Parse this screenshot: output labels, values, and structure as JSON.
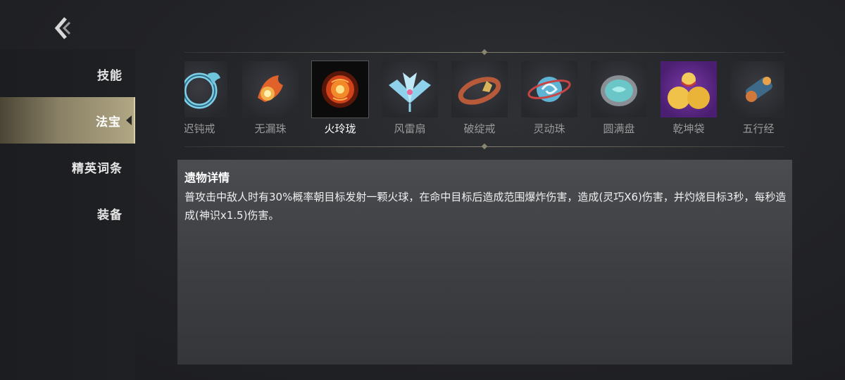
{
  "sidebar": {
    "items": [
      {
        "label": "技能"
      },
      {
        "label": "法宝"
      },
      {
        "label": "精英词条"
      },
      {
        "label": "装备"
      }
    ]
  },
  "treasures": [
    {
      "label": "迟钝戒",
      "icon": "blue-dragon-ring-icon"
    },
    {
      "label": "无漏珠",
      "icon": "flame-pearl-icon"
    },
    {
      "label": "火玲珑",
      "icon": "fire-orb-icon",
      "selected": true
    },
    {
      "label": "风雷扇",
      "icon": "ice-fan-icon"
    },
    {
      "label": "破绽戒",
      "icon": "golden-ring-icon"
    },
    {
      "label": "灵动珠",
      "icon": "swirl-pearl-icon"
    },
    {
      "label": "圆满盘",
      "icon": "jade-plate-icon"
    },
    {
      "label": "乾坤袋",
      "icon": "gourd-bag-icon"
    },
    {
      "label": "五行经",
      "icon": "scroll-icon"
    }
  ],
  "detail": {
    "title": "遗物详情",
    "description": "普攻击中敌人时有30%概率朝目标发射一颗火球，在命中目标后造成范围爆炸伤害，造成(灵巧X6)伤害，并灼烧目标3秒，每秒造成(神识x1.5)伤害。"
  },
  "colors": {
    "active_tab": "#b1a784",
    "panel": "#3c3e42",
    "text_dim": "#9a9a9a"
  }
}
